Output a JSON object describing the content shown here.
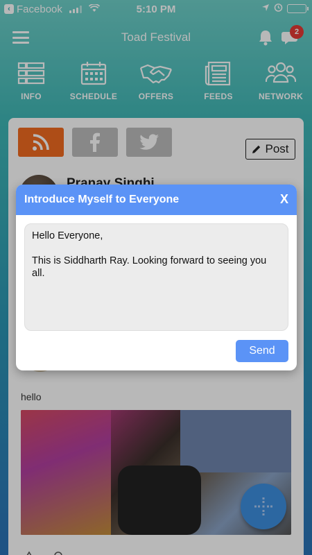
{
  "status_bar": {
    "back_app": "Facebook",
    "time": "5:10 PM",
    "battery_level_pct": 95
  },
  "header": {
    "title": "Toad Festival",
    "notification_badge": "2"
  },
  "nav": [
    {
      "label": "INFO",
      "icon": "list-icon"
    },
    {
      "label": "SCHEDULE",
      "icon": "calendar-icon"
    },
    {
      "label": "OFFERS",
      "icon": "handshake-icon"
    },
    {
      "label": "FEEDS",
      "icon": "newspaper-icon"
    },
    {
      "label": "NETWORK",
      "icon": "people-icon"
    }
  ],
  "feed": {
    "post_label": "Post",
    "author": "Pranay Singhi",
    "post_text": "hello"
  },
  "modal": {
    "title": "Introduce Myself to Everyone",
    "close": "X",
    "message": "Hello Everyone,\n\nThis is Siddharth Ray. Looking forward to seeing you all.",
    "send": "Send"
  },
  "colors": {
    "accent": "#5b93f6",
    "rss": "#f26b21",
    "badge": "#e53935",
    "fab": "#3d8fe0"
  }
}
